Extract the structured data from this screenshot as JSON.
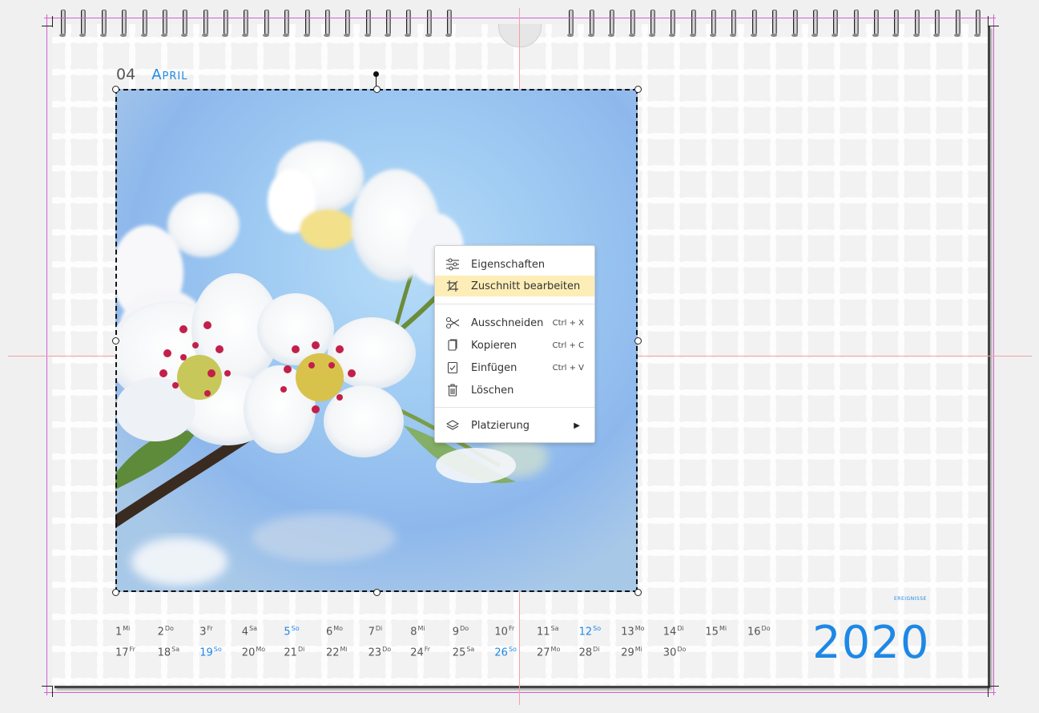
{
  "month": {
    "number": "04",
    "name": "April"
  },
  "year": "2020",
  "events_label": "EREIGNISSE",
  "context_menu": {
    "items": [
      {
        "label": "Eigenschaften",
        "icon": "sliders-icon",
        "shortcut": ""
      },
      {
        "label": "Zuschnitt bearbeiten",
        "icon": "crop-icon",
        "shortcut": "",
        "highlighted": true
      },
      {
        "label": "Ausschneiden",
        "icon": "scissors-icon",
        "shortcut": "Ctrl + X"
      },
      {
        "label": "Kopieren",
        "icon": "copy-icon",
        "shortcut": "Ctrl + C"
      },
      {
        "label": "Einfügen",
        "icon": "paste-icon",
        "shortcut": "Ctrl + V"
      },
      {
        "label": "Löschen",
        "icon": "trash-icon",
        "shortcut": ""
      },
      {
        "label": "Platzierung",
        "icon": "layers-icon",
        "shortcut": "",
        "submenu": true
      }
    ]
  },
  "days_row1": [
    {
      "d": "1",
      "w": "Mi"
    },
    {
      "d": "2",
      "w": "Do"
    },
    {
      "d": "3",
      "w": "Fr"
    },
    {
      "d": "4",
      "w": "Sa"
    },
    {
      "d": "5",
      "w": "So",
      "sunday": true
    },
    {
      "d": "6",
      "w": "Mo"
    },
    {
      "d": "7",
      "w": "Di"
    },
    {
      "d": "8",
      "w": "Mi"
    },
    {
      "d": "9",
      "w": "Do"
    },
    {
      "d": "10",
      "w": "Fr"
    },
    {
      "d": "11",
      "w": "Sa"
    },
    {
      "d": "12",
      "w": "So",
      "sunday": true
    },
    {
      "d": "13",
      "w": "Mo"
    },
    {
      "d": "14",
      "w": "Di"
    },
    {
      "d": "15",
      "w": "Mi"
    },
    {
      "d": "16",
      "w": "Do"
    }
  ],
  "days_row2": [
    {
      "d": "17",
      "w": "Fr"
    },
    {
      "d": "18",
      "w": "Sa"
    },
    {
      "d": "19",
      "w": "So",
      "sunday": true
    },
    {
      "d": "20",
      "w": "Mo"
    },
    {
      "d": "21",
      "w": "Di"
    },
    {
      "d": "22",
      "w": "Mi"
    },
    {
      "d": "23",
      "w": "Do"
    },
    {
      "d": "24",
      "w": "Fr"
    },
    {
      "d": "25",
      "w": "Sa"
    },
    {
      "d": "26",
      "w": "So",
      "sunday": true
    },
    {
      "d": "27",
      "w": "Mo"
    },
    {
      "d": "28",
      "w": "Di"
    },
    {
      "d": "29",
      "w": "Mi"
    },
    {
      "d": "30",
      "w": "Do"
    }
  ],
  "colors": {
    "accent": "#1e88e5",
    "menu_highlight": "#fdeeb8",
    "guide": "#f4a0a8",
    "bleed": "#d060d0"
  }
}
